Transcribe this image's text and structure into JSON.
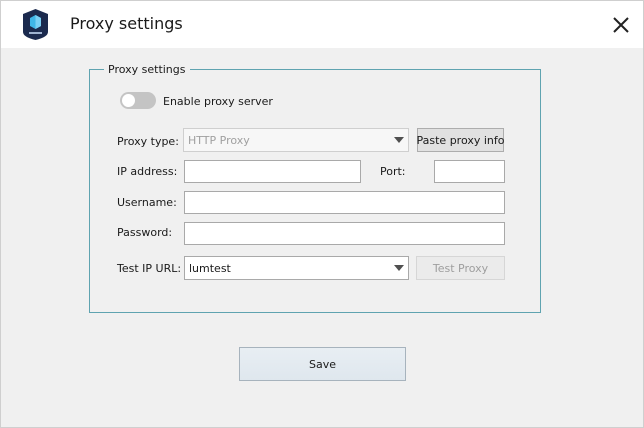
{
  "window": {
    "title": "Proxy settings"
  },
  "group": {
    "legend": "Proxy settings",
    "toggle": {
      "label": "Enable proxy server",
      "enabled": false
    },
    "proxy_type": {
      "label": "Proxy type:",
      "value": "HTTP Proxy",
      "disabled": true
    },
    "paste_button": "Paste proxy info",
    "ip": {
      "label": "IP address:",
      "value": ""
    },
    "port": {
      "label": "Port:",
      "value": ""
    },
    "username": {
      "label": "Username:",
      "value": ""
    },
    "password": {
      "label": "Password:",
      "value": ""
    },
    "test_url": {
      "label": "Test IP URL:",
      "value": "lumtest"
    },
    "test_button": "Test Proxy"
  },
  "save_button": "Save",
  "colors": {
    "group_border": "#5fa3b0",
    "logo_bg": "#1b2a4e",
    "logo_accent": "#3fb6e8"
  }
}
